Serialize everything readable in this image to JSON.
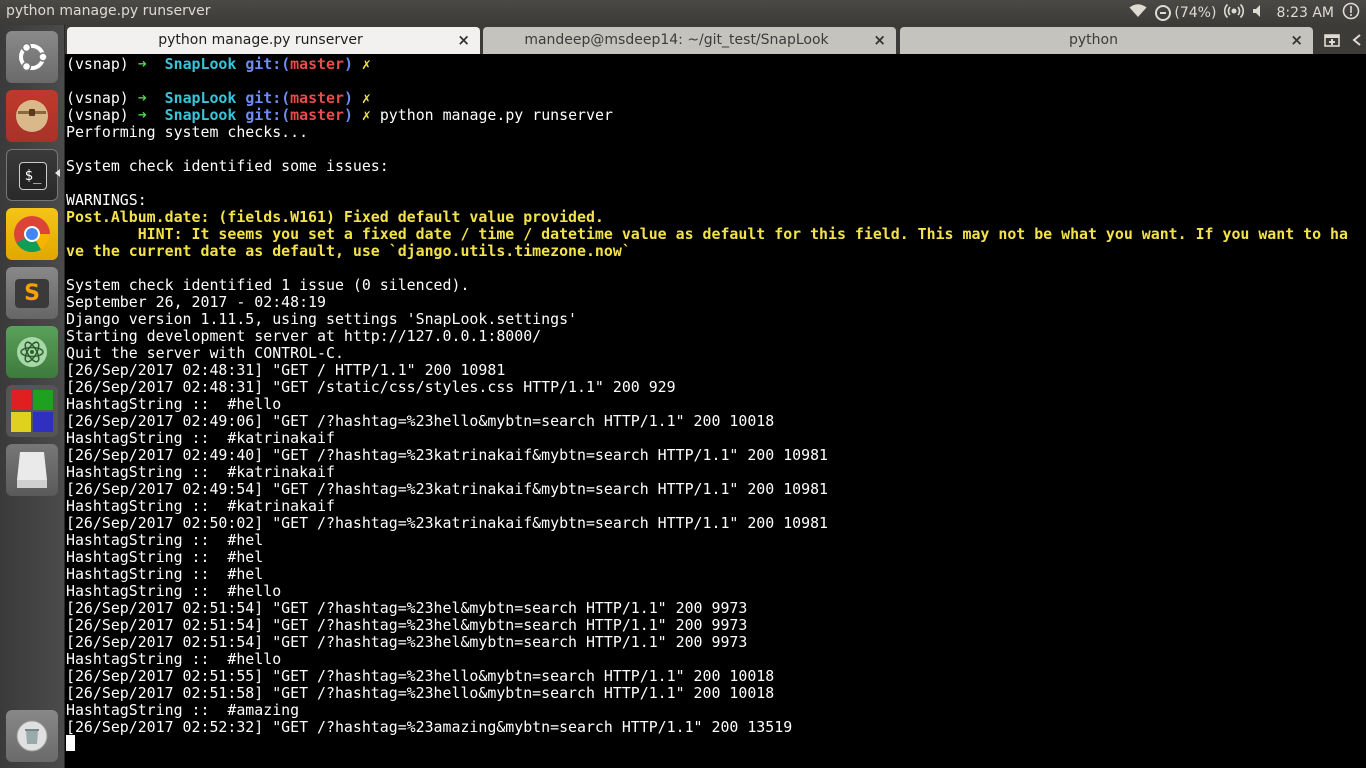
{
  "top_panel": {
    "window_title": "python manage.py runserver",
    "battery": "(74%)",
    "clock": "8:23 AM"
  },
  "launcher": {
    "items": [
      {
        "name": "dash-home",
        "icon": "ubuntu-logo-icon"
      },
      {
        "name": "files",
        "icon": "archive-icon"
      },
      {
        "name": "terminal",
        "icon": "terminal-icon",
        "glyph": "$_"
      },
      {
        "name": "chrome",
        "icon": "chrome-icon"
      },
      {
        "name": "sublime-text",
        "icon": "sublime-icon",
        "glyph": "S"
      },
      {
        "name": "atom",
        "icon": "atom-icon"
      },
      {
        "name": "workspace-switcher",
        "icon": "workspaces-icon"
      },
      {
        "name": "removable-drive",
        "icon": "drive-icon"
      },
      {
        "name": "trash",
        "icon": "trash-icon"
      }
    ]
  },
  "tabs": [
    {
      "label": "python manage.py runserver",
      "close": "×",
      "active": true
    },
    {
      "label": "mandeep@msdeep14: ~/git_test/SnapLook",
      "close": "×",
      "active": false
    },
    {
      "label": "python",
      "close": "×",
      "active": false
    }
  ],
  "terminal": {
    "prompt": {
      "env": "(vsnap) ",
      "arrow": "➜  ",
      "dir": "SnapLook ",
      "git": "git:(",
      "branch": "master",
      "git_close": ") ",
      "dirty": "✗ "
    },
    "command": "python manage.py runserver",
    "lines": {
      "l03": "Performing system checks...",
      "l04": "",
      "l05": "System check identified some issues:",
      "l06": "",
      "l07": "WARNINGS:",
      "l08": "Post.Album.date: (fields.W161) Fixed default value provided.",
      "l09": "        HINT: It seems you set a fixed date / time / datetime value as default for this field. This may not be what you want. If you want to ha",
      "l10": "ve the current date as default, use `django.utils.timezone.now`",
      "l11": "",
      "l12": "System check identified 1 issue (0 silenced).",
      "l13": "September 26, 2017 - 02:48:19",
      "l14": "Django version 1.11.5, using settings 'SnapLook.settings'",
      "l15": "Starting development server at http://127.0.0.1:8000/",
      "l16": "Quit the server with CONTROL-C.",
      "l17": "[26/Sep/2017 02:48:31] \"GET / HTTP/1.1\" 200 10981",
      "l18": "[26/Sep/2017 02:48:31] \"GET /static/css/styles.css HTTP/1.1\" 200 929",
      "l19": "HashtagString ::  #hello",
      "l20": "[26/Sep/2017 02:49:06] \"GET /?hashtag=%23hello&mybtn=search HTTP/1.1\" 200 10018",
      "l21": "HashtagString ::  #katrinakaif",
      "l22": "[26/Sep/2017 02:49:40] \"GET /?hashtag=%23katrinakaif&mybtn=search HTTP/1.1\" 200 10981",
      "l23": "HashtagString ::  #katrinakaif",
      "l24": "[26/Sep/2017 02:49:54] \"GET /?hashtag=%23katrinakaif&mybtn=search HTTP/1.1\" 200 10981",
      "l25": "HashtagString ::  #katrinakaif",
      "l26": "[26/Sep/2017 02:50:02] \"GET /?hashtag=%23katrinakaif&mybtn=search HTTP/1.1\" 200 10981",
      "l27": "HashtagString ::  #hel",
      "l28": "HashtagString ::  #hel",
      "l29": "HashtagString ::  #hel",
      "l30": "HashtagString ::  #hello",
      "l31": "[26/Sep/2017 02:51:54] \"GET /?hashtag=%23hel&mybtn=search HTTP/1.1\" 200 9973",
      "l32": "[26/Sep/2017 02:51:54] \"GET /?hashtag=%23hel&mybtn=search HTTP/1.1\" 200 9973",
      "l33": "[26/Sep/2017 02:51:54] \"GET /?hashtag=%23hel&mybtn=search HTTP/1.1\" 200 9973",
      "l34": "HashtagString ::  #hello",
      "l35": "[26/Sep/2017 02:51:55] \"GET /?hashtag=%23hello&mybtn=search HTTP/1.1\" 200 10018",
      "l36": "[26/Sep/2017 02:51:58] \"GET /?hashtag=%23hello&mybtn=search HTTP/1.1\" 200 10018",
      "l37": "HashtagString ::  #amazing",
      "l38": "[26/Sep/2017 02:52:32] \"GET /?hashtag=%23amazing&mybtn=search HTTP/1.1\" 200 13519"
    }
  },
  "colors": {
    "terminal_bg": "#000000",
    "prompt_arrow": "#4bd84b",
    "prompt_dir": "#39c5d7",
    "prompt_git": "#6f8cf5",
    "prompt_branch": "#e84c4c",
    "warning": "#f3e24a"
  }
}
